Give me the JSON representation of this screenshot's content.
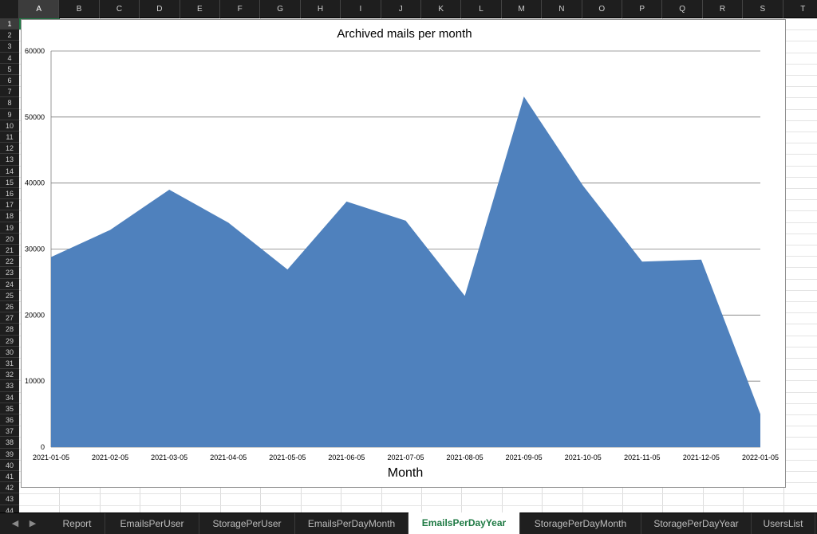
{
  "spreadsheet": {
    "columns": [
      "A",
      "B",
      "C",
      "D",
      "E",
      "F",
      "G",
      "H",
      "I",
      "J",
      "K",
      "L",
      "M",
      "N",
      "O",
      "P",
      "Q",
      "R",
      "S",
      "T"
    ],
    "rows": [
      "1",
      "2",
      "3",
      "4",
      "5",
      "6",
      "7",
      "8",
      "9",
      "10",
      "11",
      "12",
      "13",
      "14",
      "15",
      "16",
      "17",
      "18",
      "19",
      "20",
      "21",
      "22",
      "23",
      "24",
      "25",
      "26",
      "27",
      "28",
      "29",
      "30",
      "31",
      "32",
      "33",
      "34",
      "35",
      "36",
      "37",
      "38",
      "39",
      "40",
      "41",
      "42",
      "43",
      "44"
    ],
    "selected_cell": "A1"
  },
  "sheet_tabs": {
    "tabs": [
      "Report",
      "EmailsPerUser",
      "StoragePerUser",
      "EmailsPerDayMonth",
      "EmailsPerDayYear",
      "StoragePerDayMonth",
      "StoragePerDayYear",
      "UsersList"
    ],
    "active": "EmailsPerDayYear",
    "nav_prev_icon": "triangle-left-icon",
    "nav_next_icon": "triangle-right-icon"
  },
  "chart_data": {
    "type": "area",
    "title": "Archived mails per month",
    "xlabel": "Month",
    "ylabel": "",
    "x": [
      "2021-01-05",
      "2021-02-05",
      "2021-03-05",
      "2021-04-05",
      "2021-05-05",
      "2021-06-05",
      "2021-07-05",
      "2021-08-05",
      "2021-09-05",
      "2021-10-05",
      "2021-11-05",
      "2021-12-05",
      "2022-01-05"
    ],
    "series": [
      {
        "values": [
          28800,
          32900,
          39000,
          34000,
          26900,
          37200,
          34300,
          22900,
          53100,
          39600,
          28100,
          28400,
          5000
        ],
        "color": "#4f81bd"
      }
    ],
    "ylim": [
      0,
      60000
    ],
    "yticks": [
      0,
      10000,
      20000,
      30000,
      40000,
      50000,
      60000
    ],
    "grid": true,
    "legend": "none"
  }
}
